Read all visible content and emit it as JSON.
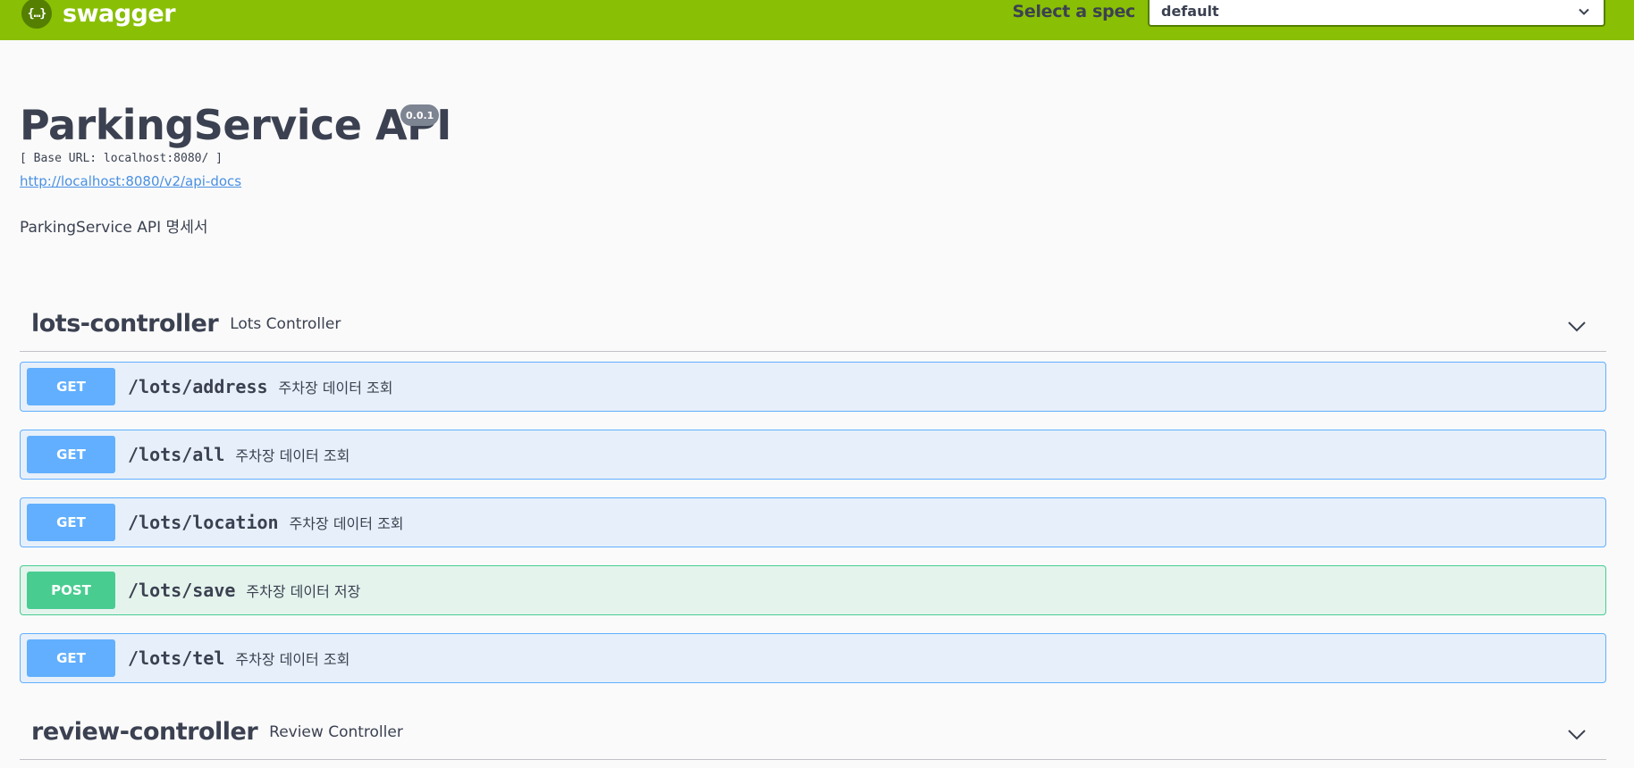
{
  "topbar": {
    "logo_badge": "{…}",
    "logo_text": "swagger",
    "spec_label": "Select a spec",
    "spec_selected": "default"
  },
  "info": {
    "title": "ParkingService API",
    "version": "0.0.1",
    "base_url": "[ Base URL: localhost:8080/ ]",
    "docs_link": "http://localhost:8080/v2/api-docs",
    "description": "ParkingService API 명세서"
  },
  "tags": [
    {
      "name": "lots-controller",
      "description": "Lots Controller",
      "operations": [
        {
          "method": "GET",
          "path": "/lots/address",
          "summary": "주차장 데이터 조회"
        },
        {
          "method": "GET",
          "path": "/lots/all",
          "summary": "주차장 데이터 조회"
        },
        {
          "method": "GET",
          "path": "/lots/location",
          "summary": "주차장 데이터 조회"
        },
        {
          "method": "POST",
          "path": "/lots/save",
          "summary": "주차장 데이터 저장"
        },
        {
          "method": "GET",
          "path": "/lots/tel",
          "summary": "주차장 데이터 조회"
        }
      ]
    },
    {
      "name": "review-controller",
      "description": "Review Controller"
    }
  ],
  "colors": {
    "topbar": "#89bf04",
    "get": "#61affe",
    "post": "#49cc90",
    "text": "#3b4151",
    "link": "#4990e2"
  }
}
